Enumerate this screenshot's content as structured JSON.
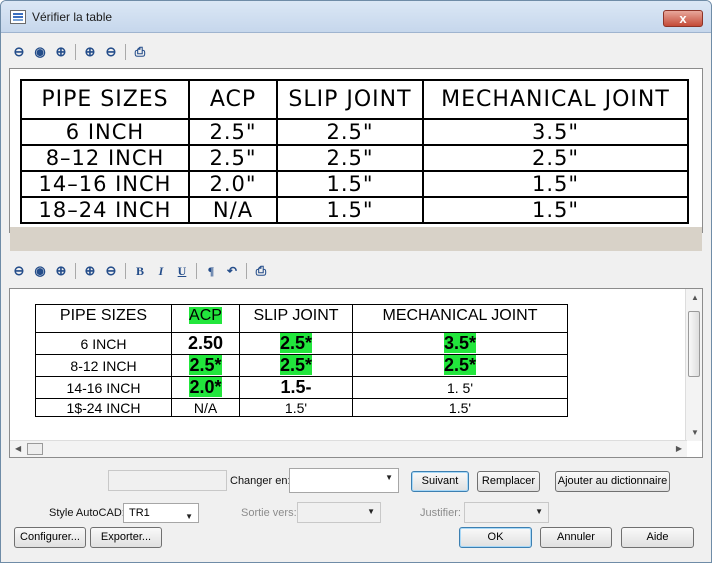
{
  "window": {
    "title": "Vérifier la table",
    "close_symbol": "x"
  },
  "toolbar_top": {
    "icons": [
      "zoom-out-icon",
      "zoom-window-icon",
      "zoom-extents-icon",
      "zoom-in-icon",
      "zoom-previous-icon",
      "print-preview-icon"
    ]
  },
  "drawing_table": {
    "headers": [
      "PIPE SIZES",
      "ACP",
      "SLIP JOINT",
      "MECHANICAL JOINT"
    ],
    "rows": [
      [
        "6 INCH",
        "2.5\"",
        "2.5\"",
        "3.5\""
      ],
      [
        "8–12 INCH",
        "2.5\"",
        "2.5\"",
        "2.5\""
      ],
      [
        "14–16 INCH",
        "2.0\"",
        "1.5\"",
        "1.5\""
      ],
      [
        "18–24 INCH",
        "N/A",
        "1.5\"",
        "1.5\""
      ]
    ]
  },
  "toolbar_editor": {
    "bold": "B",
    "italic": "I",
    "underline": "U",
    "paragraph": "¶",
    "undo": "↶"
  },
  "ocr_table": {
    "headers": [
      "PIPE SIZES",
      "ACP",
      "SLIP JOINT",
      "MECHANICAL JOINT"
    ],
    "rows": [
      [
        "6 INCH",
        "2.50",
        "2.5*",
        "3.5*"
      ],
      [
        "8-12 INCH",
        "2.5*",
        "2.5*",
        "2.5*"
      ],
      [
        "14-16 INCH",
        "2.0*",
        "1.5-",
        "1. 5'"
      ],
      [
        "1$-24 INCH",
        "N/A",
        "1.5'",
        "1.5'"
      ]
    ]
  },
  "controls": {
    "change_label": "Changer en:",
    "next": "Suivant",
    "replace": "Remplacer",
    "add_dictionary": "Ajouter au dictionnaire",
    "style_label": "Style AutoCAD:",
    "style_value": "TR1",
    "output_label": "Sortie vers:",
    "justify_label": "Justifier:",
    "configure": "Configurer...",
    "export": "Exporter...",
    "ok": "OK",
    "cancel": "Annuler",
    "help": "Aide"
  }
}
